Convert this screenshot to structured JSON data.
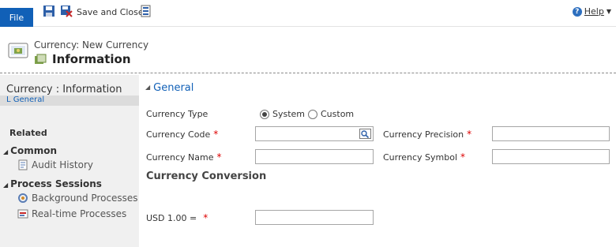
{
  "ribbon": {
    "file_label": "File",
    "save_close_label": "Save and Close",
    "help_label": "Help"
  },
  "header": {
    "entity_label": "Currency: New Currency",
    "form_title": "Information"
  },
  "nav": {
    "title": "Currency : Information",
    "selected_item": "L General",
    "related_label": "Related",
    "groups": [
      {
        "label": "Common",
        "items": [
          {
            "label": "Audit History",
            "icon": "audit-history-icon"
          }
        ]
      },
      {
        "label": "Process Sessions",
        "items": [
          {
            "label": "Background Processes",
            "icon": "background-processes-icon"
          },
          {
            "label": "Real-time Processes",
            "icon": "realtime-processes-icon"
          }
        ]
      }
    ]
  },
  "form": {
    "section_title": "General",
    "currency_type_label": "Currency Type",
    "currency_type_options": [
      "System",
      "Custom"
    ],
    "currency_type_selected": "System",
    "currency_code_label": "Currency Code",
    "currency_code_value": "",
    "currency_precision_label": "Currency Precision",
    "currency_precision_value": "",
    "currency_name_label": "Currency Name",
    "currency_name_value": "",
    "currency_symbol_label": "Currency Symbol",
    "currency_symbol_value": "",
    "conversion_title": "Currency Conversion",
    "exchange_label": "USD 1.00 =",
    "exchange_value": "",
    "required_marker": "*"
  },
  "colors": {
    "accent": "#1160b7",
    "required": "#dd0000",
    "nav_background": "#f0f0f0"
  }
}
